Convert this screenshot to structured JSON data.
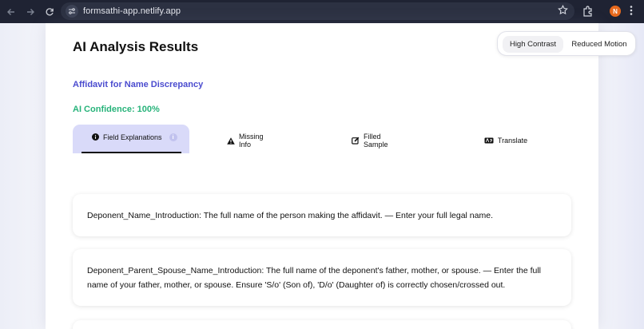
{
  "browser": {
    "url": "formsathi-app.netlify.app",
    "profile_initial": "N"
  },
  "a11y": {
    "high_contrast": "High Contrast",
    "reduced_motion": "Reduced Motion"
  },
  "header": {
    "title": "AI Analysis Results",
    "form_name": "Affidavit for Name Discrepancy",
    "confidence": "AI Confidence: 100%"
  },
  "tabs": [
    {
      "label": "Field Explanations",
      "icon": "info-icon",
      "active": true
    },
    {
      "label": "Missing Info",
      "icon": "warning-icon",
      "active": false
    },
    {
      "label": "Filled Sample",
      "icon": "edit-icon",
      "active": false
    },
    {
      "label": "Translate",
      "icon": "language-icon",
      "active": false
    }
  ],
  "fields": [
    {
      "text": "Deponent_Name_Introduction: The full name of the person making the affidavit. — Enter your full legal name."
    },
    {
      "text": "Deponent_Parent_Spouse_Name_Introduction: The full name of the deponent's father, mother, or spouse. — Enter the full name of your father, mother, or spouse. Ensure 'S/o' (Son of), 'D/o' (Daughter of) is correctly chosen/crossed out."
    },
    {
      "text": ""
    }
  ],
  "colors": {
    "accent": "#4b4ccf",
    "success": "#27b37a",
    "active_tab": "#d9daf9"
  }
}
